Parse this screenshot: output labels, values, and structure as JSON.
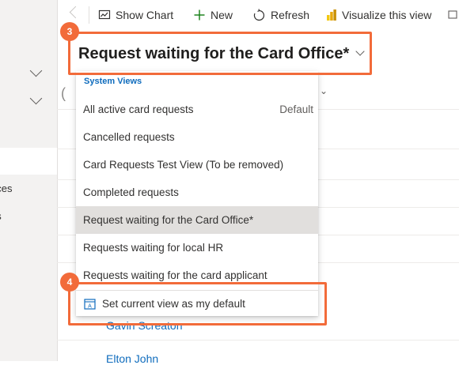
{
  "toolbar": {
    "show_chart": "Show Chart",
    "new": "New",
    "refresh": "Refresh",
    "visualize": "Visualize this view"
  },
  "sidebar": {
    "items": [
      {
        "label": "s"
      },
      {
        "label": "nces"
      },
      {
        "label": "es"
      }
    ]
  },
  "view": {
    "title": "Request waiting for the Card Office*"
  },
  "dropdown": {
    "header": "System Views",
    "items": [
      {
        "label": "All active card requests",
        "badge": "Default"
      },
      {
        "label": "Cancelled requests"
      },
      {
        "label": "Card Requests Test View (To be removed)"
      },
      {
        "label": "Completed requests"
      },
      {
        "label": "Request waiting for the Card Office*"
      },
      {
        "label": "Requests waiting for local HR"
      },
      {
        "label": "Requests waiting for the card applicant"
      }
    ],
    "footer": "Set current view as my default"
  },
  "list": {
    "rows": [
      "Gavin Screaton",
      "Elton John"
    ]
  },
  "callouts": {
    "step3": "3",
    "step4": "4",
    "color": "#f26b3a"
  },
  "colors": {
    "accent": "#0f6cbd",
    "selected_bg": "#e1dfdd"
  },
  "icons": [
    "chart-icon",
    "plus-icon",
    "refresh-icon",
    "power-bi-icon",
    "view-default-icon"
  ]
}
